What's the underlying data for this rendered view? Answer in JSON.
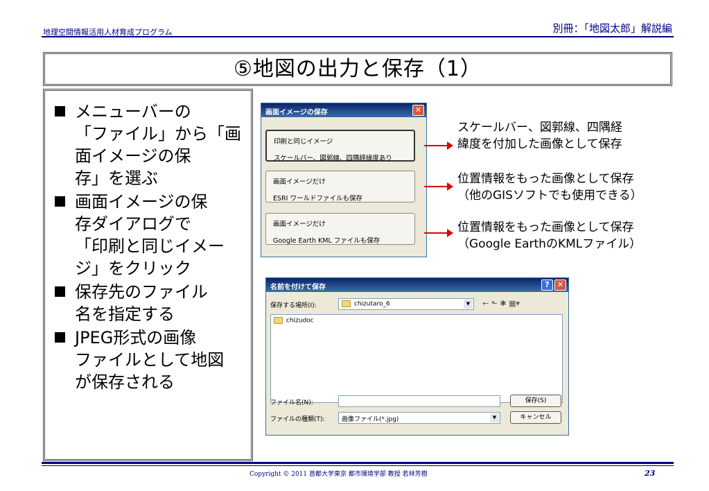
{
  "header": {
    "left": "地理空間情報活用人材育成プログラム",
    "right": "別冊：「地図太郎」解説編"
  },
  "title": "⑤地図の出力と保存（1）",
  "bullets": [
    "メニューバーの\n「ファイル」から「画\n面イメージの保\n存」を選ぶ",
    "画面イメージの保\n存ダイアログで\n「印刷と同じイメー\nジ」をクリック",
    "保存先のファイル\n名を指定する",
    "JPEG形式の画像\nファイルとして地図\nが保存される"
  ],
  "dialog1": {
    "title": "画面イメージの保存",
    "close": "✕",
    "options": [
      {
        "line1": "印刷と同じイメージ",
        "line2": "スケールバー、図郭線、四隅経緯度あり"
      },
      {
        "line1": "画面イメージだけ",
        "line2": "ESRI ワールドファイルも保存"
      },
      {
        "line1": "画面イメージだけ",
        "line2": "Google Earth KML ファイルも保存"
      }
    ]
  },
  "notes": [
    "スケールバー、図郭線、四隅経\n緯度を付加した画像として保存",
    "位置情報をもった画像として保存\n（他のGISソフトでも使用できる）",
    "位置情報をもった画像として保存\n（Google EarthのKMLファイル）"
  ],
  "dialog2": {
    "title": "名前を付けて保存",
    "help": "?",
    "close": "✕",
    "location_label": "保存する場所(I):",
    "location_value": "chizutaro_6",
    "tools": "← ⬑ ✱ ▦▾",
    "list_item": "chizudoc",
    "filename_label": "ファイル名(N):",
    "filename_value": "",
    "filetype_label": "ファイルの種類(T):",
    "filetype_value": "画像ファイル(*.jpg)",
    "save_button": "保存(S)",
    "cancel_button": "キャンセル"
  },
  "footer": {
    "copyright": "Copyright  ©  2011  首都大学東京 都市環境学部  教授  若林芳樹",
    "page": "23"
  }
}
